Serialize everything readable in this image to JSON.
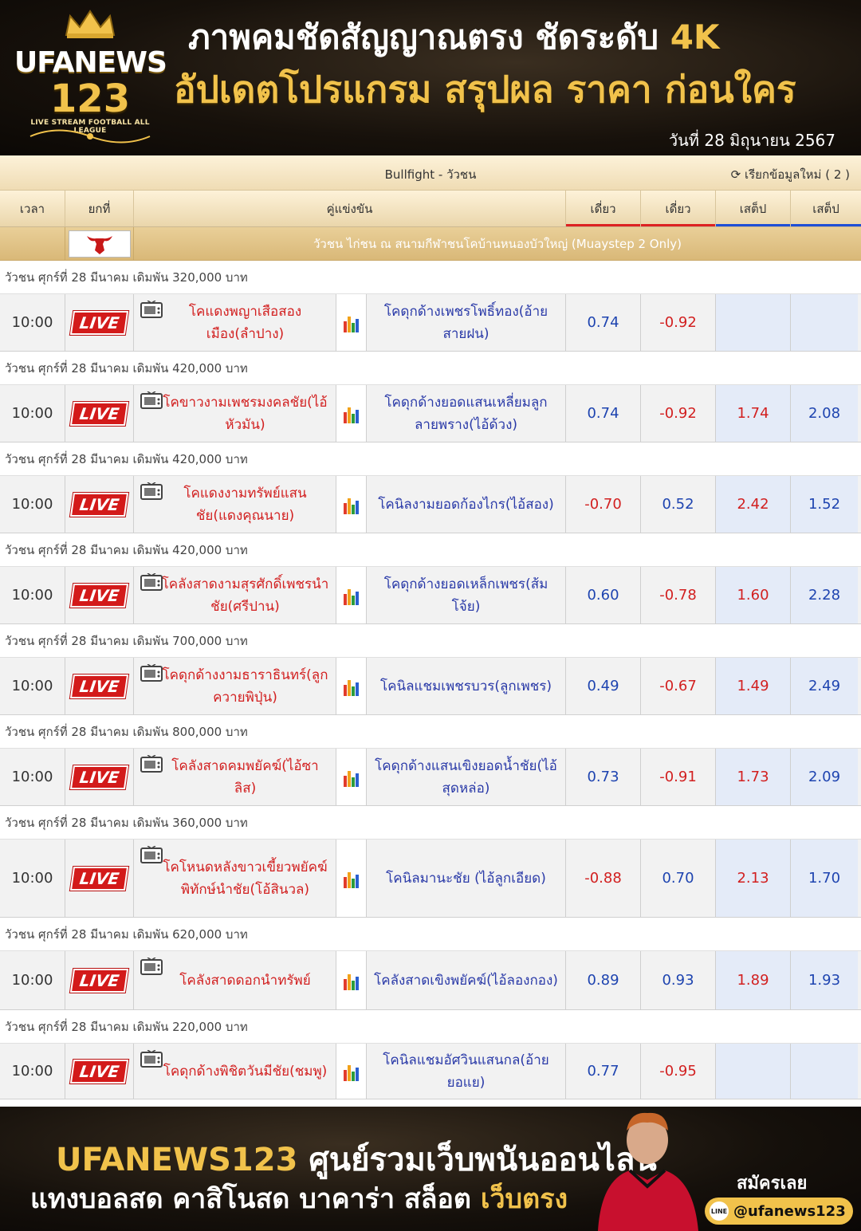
{
  "header": {
    "logo": {
      "brand_top": "UFANEWS",
      "brand_num": "123",
      "tagline": "LIVE STREAM FOOTBALL ALL LEAGUE"
    },
    "headline1_main": "ภาพคมชัดสัญญาณตรง ชัดระดับ ",
    "headline1_accent": "4K",
    "headline2": "อัปเดตโปรแกรม สรุปผล ราคา ก่อนใคร",
    "date": "วันที่ 28 มิถุนายน 2567"
  },
  "board": {
    "sport_title": "Bullfight - วัวชน",
    "refresh": "เรียกข้อมูลใหม่ ( 2 )",
    "columns": {
      "time": "เวลา",
      "round": "ยกที่",
      "match": "คู่แข่งขัน",
      "odd1": "เดี่ยว",
      "odd2": "เดี่ยว",
      "odd3": "เสต็ป",
      "odd4": "เสต็ป"
    },
    "league": "วัวชน ไก่ชน ณ สนามกีฬาชนโคบ้านหนองบัวใหญ่ (Muaystep 2 Only)",
    "live_label": "LIVE",
    "matches": [
      {
        "info": "วัวชน ศุกร์ที่ 28 มีนาคม เดิมพัน 320,000 บาท",
        "time": "10:00",
        "home": "โคแดงพญาเสือสองเมือง(ลำปาง)",
        "away": "โคดุกด้างเพชรโพธิ์ทอง(อ้ายสายฝน)",
        "o1": "0.74",
        "o2": "-0.92",
        "o3": "",
        "o4": ""
      },
      {
        "info": "วัวชน ศุกร์ที่ 28 มีนาคม เดิมพัน 420,000 บาท",
        "time": "10:00",
        "home": "โคขาวงามเพชรมงคลชัย(ไอ้หัวมัน)",
        "away": "โคดุกด้างยอดแสนเหลี่ยมลูกลายพราง(ไอ้ด้วง)",
        "o1": "0.74",
        "o2": "-0.92",
        "o3": "1.74",
        "o4": "2.08"
      },
      {
        "info": "วัวชน ศุกร์ที่ 28 มีนาคม เดิมพัน 420,000 บาท",
        "time": "10:00",
        "home": "โคแดงงามทรัพย์แสนชัย(แดงคุณนาย)",
        "away": "โคนิลงามยอดก้องไกร(ไอ้สอง)",
        "o1": "-0.70",
        "o2": "0.52",
        "o3": "2.42",
        "o4": "1.52"
      },
      {
        "info": "วัวชน ศุกร์ที่ 28 มีนาคม เดิมพัน 420,000 บาท",
        "time": "10:00",
        "home": "โคลังสาดงามสุรศักดิ์เพชรนำชัย(ศรีปาน)",
        "away": "โคดุกด้างยอดเหล็กเพชร(ส้มโจ้ย)",
        "o1": "0.60",
        "o2": "-0.78",
        "o3": "1.60",
        "o4": "2.28"
      },
      {
        "info": "วัวชน ศุกร์ที่ 28 มีนาคม เดิมพัน 700,000 บาท",
        "time": "10:00",
        "home": "โคดุกด้างงามธาราธินทร์(ลูกควายพิปุ่น)",
        "away": "โคนิลแชมเพชรบวร(ลูกเพชร)",
        "o1": "0.49",
        "o2": "-0.67",
        "o3": "1.49",
        "o4": "2.49"
      },
      {
        "info": "วัวชน ศุกร์ที่ 28 มีนาคม เดิมพัน 800,000 บาท",
        "time": "10:00",
        "home": "โคลังสาดคมพยัคฆ์(ไอ้ซาลิส)",
        "away": "โคดุกด้างแสนเขิงยอดน้ำชัย(ไอ้สุดหล่อ)",
        "o1": "0.73",
        "o2": "-0.91",
        "o3": "1.73",
        "o4": "2.09"
      },
      {
        "info": "วัวชน ศุกร์ที่ 28 มีนาคม เดิมพัน 360,000 บาท",
        "time": "10:00",
        "home": "โคโหนดหลังขาวเขี้ยวพยัคฆ์พิทักษ์นำชัย(โอ้สินวล)",
        "away": "โคนิลมานะชัย (ไอ้ลูกเอียด)",
        "o1": "-0.88",
        "o2": "0.70",
        "o3": "2.13",
        "o4": "1.70"
      },
      {
        "info": "วัวชน ศุกร์ที่ 28 มีนาคม เดิมพัน 620,000 บาท",
        "time": "10:00",
        "home": "โคลังสาดดอกนำทรัพย์",
        "away": "โคลังสาดเขิงพยัคฆ์(ไอ้ลองกอง)",
        "o1": "0.89",
        "o2": "0.93",
        "o3": "1.89",
        "o4": "1.93"
      },
      {
        "info": "วัวชน ศุกร์ที่ 28 มีนาคม เดิมพัน 220,000 บาท",
        "time": "10:00",
        "home": "โคดุกด้างพิชิตวันมีชัย(ชมพู)",
        "away": "โคนิลแชมอัศวินแสนกล(อ้ายยอแย)",
        "o1": "0.77",
        "o2": "-0.95",
        "o3": "",
        "o4": ""
      }
    ]
  },
  "footer": {
    "brand": "UFANEWS123",
    "line1_rest": " ศูนย์รวมเว็บพนันออนไลน์",
    "line2_main": "แทงบอลสด คาสิโนสด บาคาร่า สล็อต ",
    "line2_accent": "เว็บตรง",
    "signup": "สมัครเลย",
    "line_icon": "line-icon",
    "line_id": "@ufanews123"
  },
  "colors": {
    "gold": "#f1c24b",
    "live_red": "#d31a1a",
    "home_red": "#d22020",
    "away_blue": "#2a3aa8"
  }
}
